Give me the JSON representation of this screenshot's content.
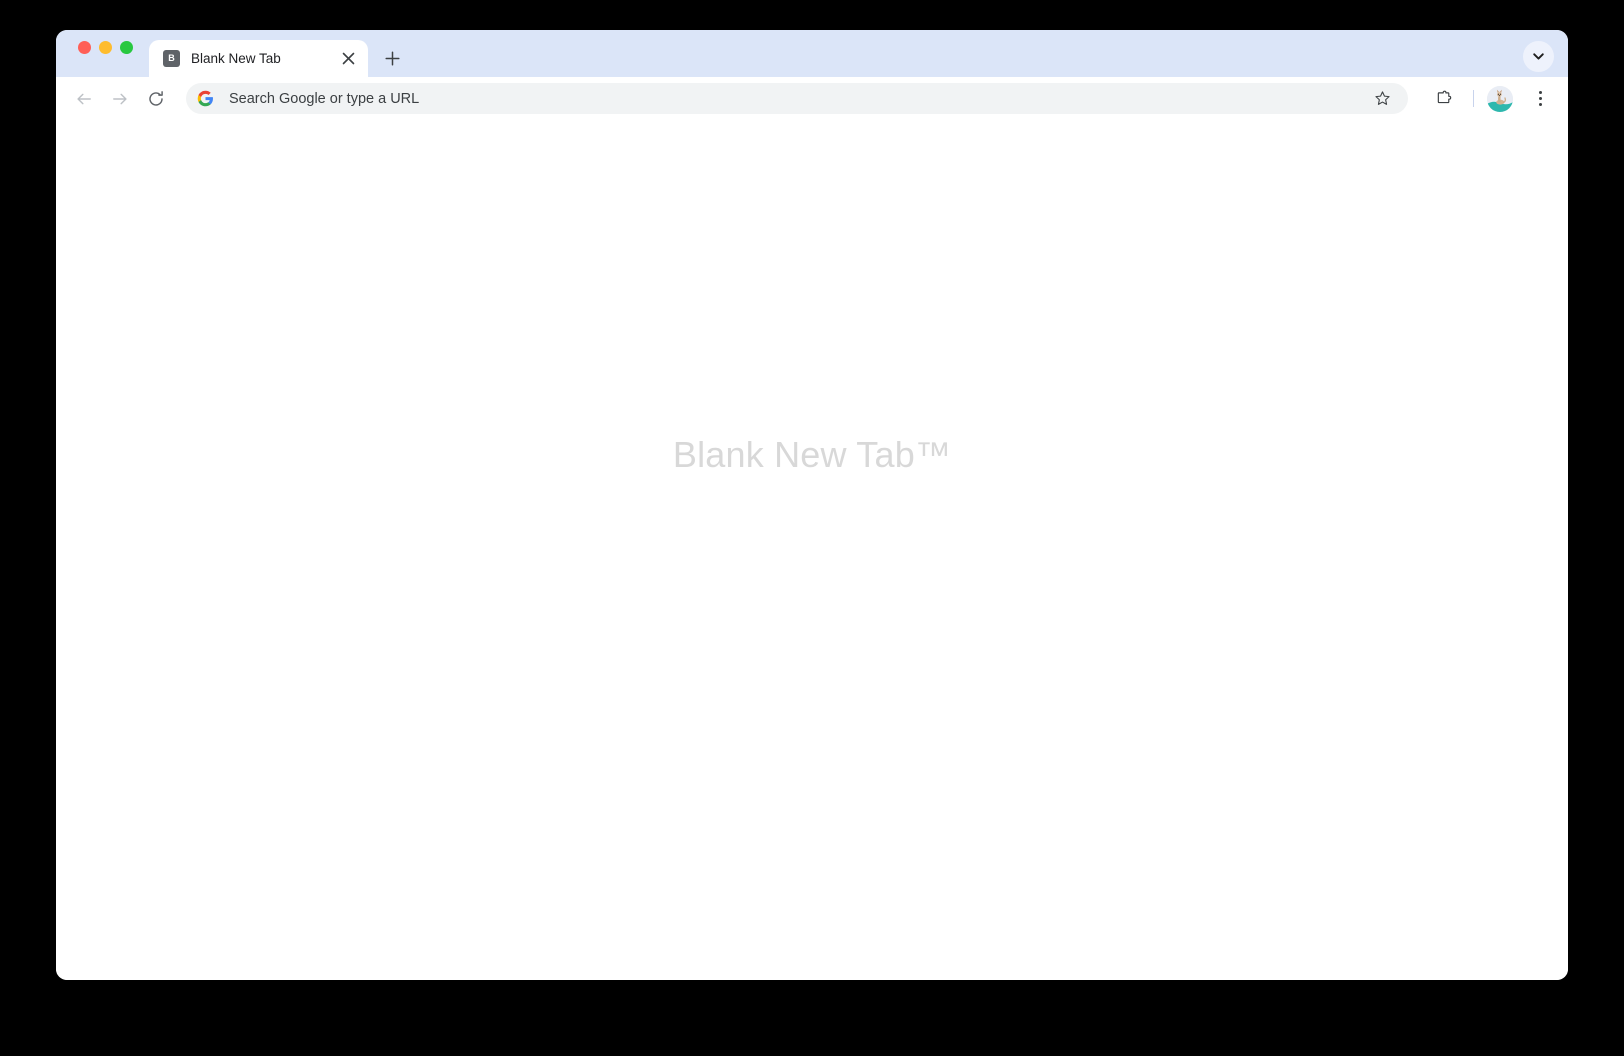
{
  "window": {
    "traffic_lights": [
      {
        "name": "close",
        "color": "#ff5f57"
      },
      {
        "name": "minimize",
        "color": "#febc2e"
      },
      {
        "name": "maximize",
        "color": "#28c840"
      }
    ],
    "tab_strip_color": "#dbe5f8",
    "chrome_color": "#ffffff"
  },
  "tabs": [
    {
      "favicon_letter": "B",
      "favicon_color": "#5f6368",
      "title": "Blank New Tab",
      "active": true,
      "close_icon": "close-icon"
    }
  ],
  "tab_strip": {
    "new_tab_icon": "plus-icon",
    "new_tab_label": "+",
    "tab_search_icon": "chevron-down-icon"
  },
  "toolbar": {
    "back_icon": "arrow-left-icon",
    "forward_icon": "arrow-right-icon",
    "reload_icon": "reload-icon",
    "bookmark_icon": "star-icon",
    "extensions_icon": "puzzle-piece-icon",
    "menu_icon": "three-dot-menu-icon",
    "avatar_icon": "profile-avatar-icon",
    "divider_color": "#c8d3ec"
  },
  "omnibox": {
    "leading_icon": "google-g-icon",
    "value": "",
    "placeholder": "Search Google or type a URL",
    "display_text": "Search Google or type a URL",
    "background": "#f1f3f4"
  },
  "page": {
    "watermark": "Blank New Tab™",
    "watermark_color": "#d8d8d8",
    "background": "#ffffff"
  }
}
